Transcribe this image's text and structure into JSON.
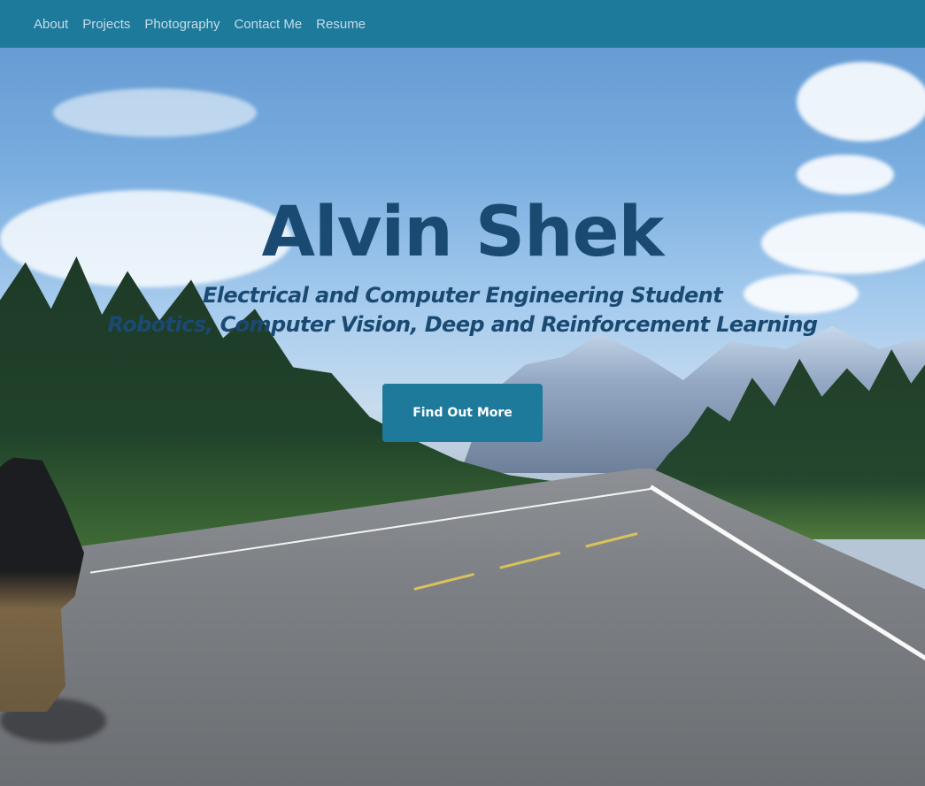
{
  "nav": {
    "items": [
      {
        "label": "About"
      },
      {
        "label": "Projects"
      },
      {
        "label": "Photography"
      },
      {
        "label": "Contact Me"
      },
      {
        "label": "Resume"
      }
    ]
  },
  "hero": {
    "title": "Alvin Shek",
    "subtitle_line1": "Electrical and Computer Engineering Student",
    "subtitle_line2": "Robotics, Computer Vision, Deep and Reinforcement Learning",
    "cta_label": "Find Out More"
  },
  "colors": {
    "nav_background": "#1e7a9a",
    "nav_text": "#c5dde8",
    "heading_text": "#1a4a72",
    "button_background": "#1e7a9a",
    "button_text": "#ffffff"
  }
}
